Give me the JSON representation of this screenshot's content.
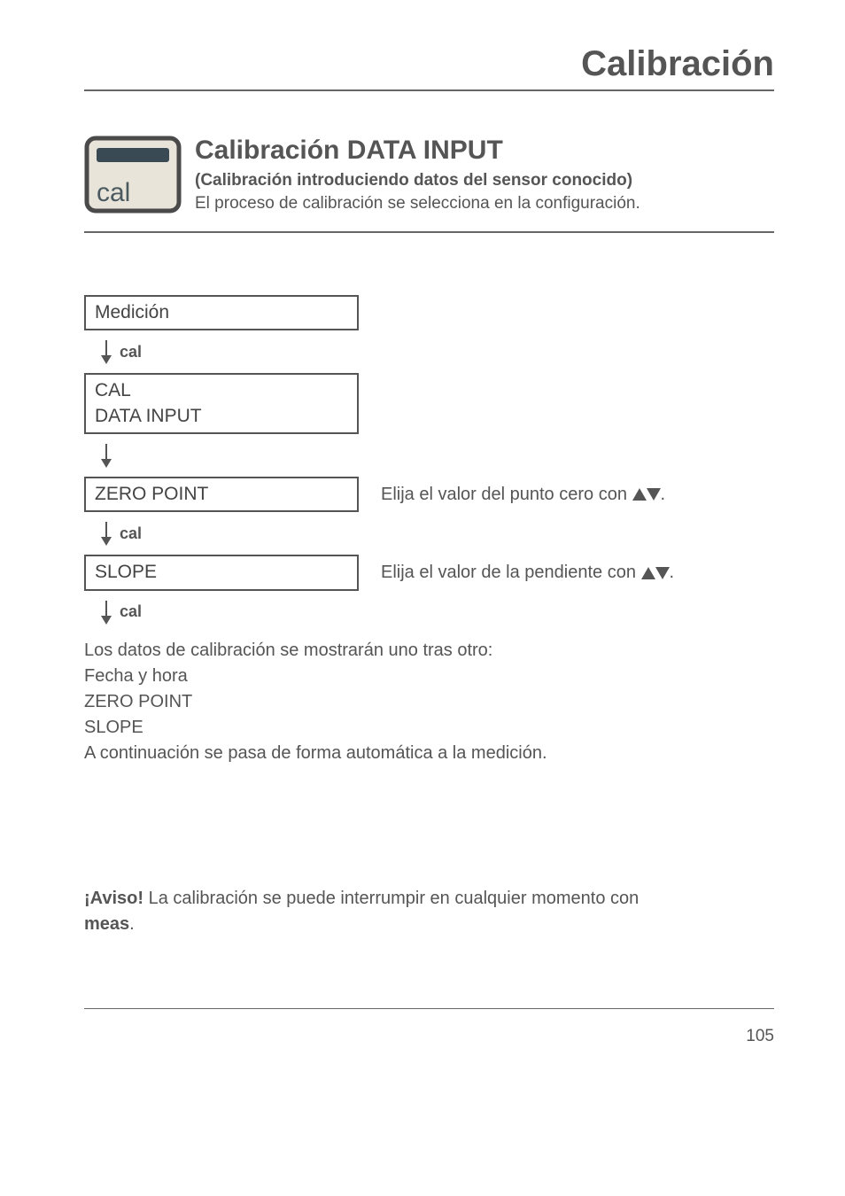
{
  "page_title": "Calibración",
  "header": {
    "subtitle": "Calibración DATA INPUT",
    "subsub": "(Calibración introduciendo datos del sensor conocido)",
    "desc": "El proceso de calibración se selecciona en la configuración.",
    "icon_label": "cal"
  },
  "flow": {
    "step1": "Medición",
    "arrow1": "cal",
    "step2_l1": "CAL",
    "step2_l2": "DATA INPUT",
    "step3": "ZERO POINT",
    "side3_a": "Elija el valor del punto cero con ",
    "side3_b": ".",
    "arrow3": "cal",
    "step4": "SLOPE",
    "side4_a": "Elija el valor de la pendiente con ",
    "side4_b": ".",
    "arrow4": "cal"
  },
  "post": {
    "l1": "Los datos de calibración se mostrarán uno tras otro:",
    "l2": "Fecha y hora",
    "l3": "ZERO POINT",
    "l4": "SLOPE",
    "l5": "A continuación se pasa de forma automática a la medición."
  },
  "aviso": {
    "bold": "¡Aviso!",
    "text1": " La calibración se puede interrumpir en cualquier momento con ",
    "bold2": "meas",
    "text2": "."
  },
  "pagenum": "105"
}
